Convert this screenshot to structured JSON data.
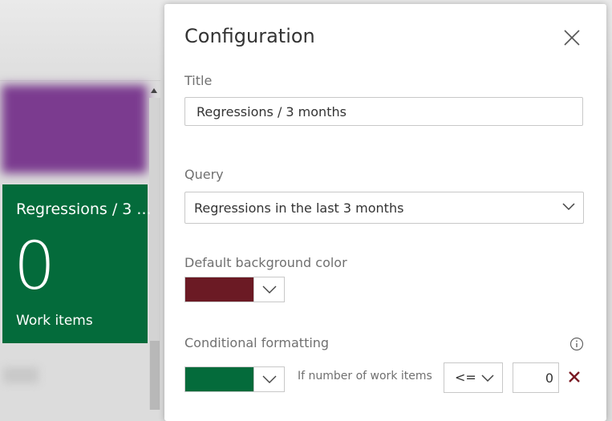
{
  "background": {
    "tile": {
      "title": "Regressions / 3 ...",
      "count": "0",
      "subtitle": "Work items",
      "color": "#046b3b"
    }
  },
  "panel": {
    "title": "Configuration",
    "close_icon": "close-icon",
    "title_field": {
      "label": "Title",
      "value": "Regressions / 3 months"
    },
    "query_field": {
      "label": "Query",
      "value": "Regressions in the last 3 months"
    },
    "default_bg": {
      "label": "Default background color",
      "color": "#6b1a24"
    },
    "conditional": {
      "label": "Conditional formatting",
      "info_icon": "info-icon",
      "rule": {
        "color": "#046b3b",
        "condition_text": "If number of work items",
        "operator": "<=",
        "value": "0",
        "remove_icon": "remove-icon"
      }
    }
  }
}
